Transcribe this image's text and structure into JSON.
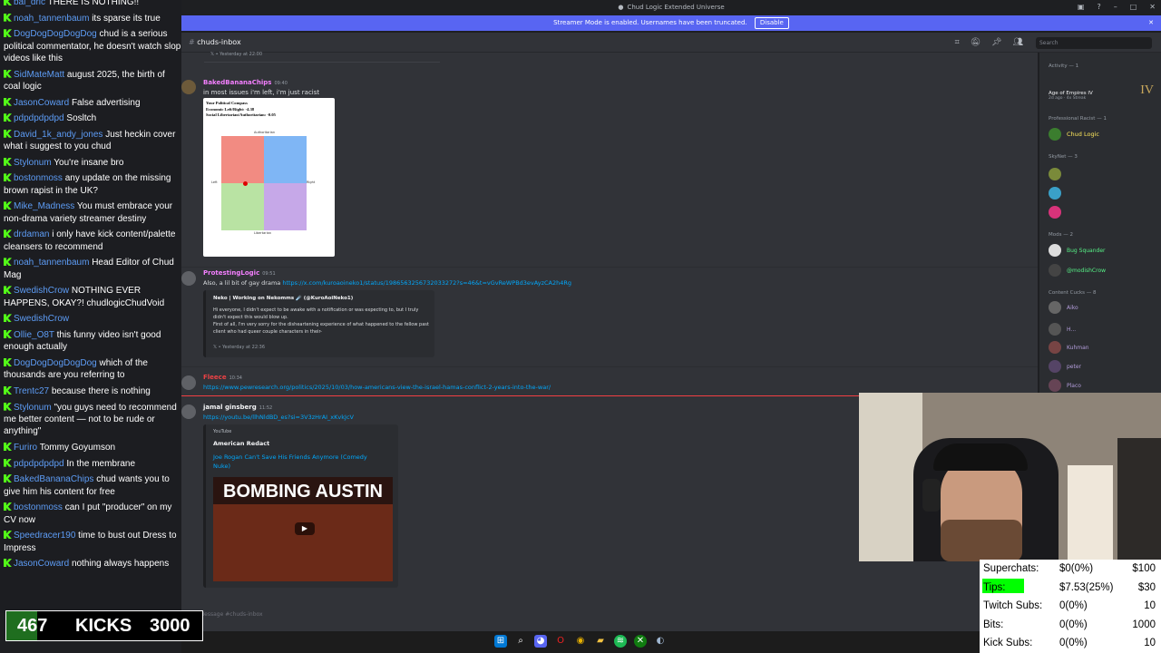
{
  "discord": {
    "window_title": "Chud Logic Extended Universe",
    "streamer_bar": {
      "text": "Streamer Mode is enabled. Usernames have been truncated.",
      "button": "Disable",
      "close": "✕"
    },
    "channel": "chuds-inbox",
    "search_placeholder": "Search",
    "message_placeholder": "Message #chuds-inbox",
    "top_embed_footer": "𝕏 • Yesterday at 22:00",
    "messages": [
      {
        "user": "BakedBananaChips",
        "time": "09:40",
        "text": "in most issues i'm left, i'm just racist",
        "color": "#f47fff"
      },
      {
        "user": "ProtestingLogic",
        "time": "09:51",
        "text": "Also, a lil bit of gay drama ",
        "link": "https://x.com/kuroaoineko1/status/1986563256732033272?s=46&t=vGvReWPBd3evAyzCA2h4Rg",
        "color": "#f47fff"
      },
      {
        "user": "Fleece",
        "time": "10:34",
        "link": "https://www.pewresearch.org/politics/2025/10/03/how-americans-view-the-israel-hamas-conflict-2-years-into-the-war/",
        "color": "#ed4245"
      },
      {
        "user": "jamal ginsberg",
        "time": "11:52",
        "link": "https://youtu.be/llhNldBD_es?si=3V3zHrAI_xKvkJcV",
        "color": "#f2f3f5"
      }
    ],
    "compass_embed": {
      "title": "Your Political Compass",
      "line1": "Economic Left/Right: -4.38",
      "line2": "Social Libertarian/Authoritarian: -0.05",
      "top": "Authoritarian",
      "bottom": "Libertarian",
      "left": "Left",
      "right": "Right"
    },
    "tweet_embed": {
      "author": "Neko | Working on Nekomms ☄️ (@KuroAoiNeko1)",
      "body": "Hi everyone, I didn't expect to be awake with a notification or was expecting to, but I truly didn't expect this would blow up.\nFirst of all, I'm very sorry for the disheartening experience of what happened to the fellow past client who had queer couple characters in their-",
      "footer": "𝕏 • Yesterday at 22:36"
    },
    "yt_embed": {
      "provider": "YouTube",
      "channel": "American Redact",
      "title": "Joe Rogan Can't Save His Friends Anymore (Comedy Nuke)",
      "thumb_text": "BOMBING AUSTIN"
    },
    "members": {
      "activity_header": "Activity — 1",
      "activity_game": "Age of Empires IV",
      "activity_meta": "2d ago · 4x Streak",
      "groups": [
        {
          "header": "Professional Racist — 1",
          "items": [
            "Chud Logic"
          ]
        },
        {
          "header": "SkyNet — 3",
          "items": [
            "",
            "",
            ""
          ]
        },
        {
          "header": "Mods — 2",
          "items": [
            "Bug Squander",
            "@modishCrow"
          ]
        },
        {
          "header": "Content Cucks — 8",
          "items": [
            "Aiko",
            "H...",
            "Kuhman",
            "peter",
            "Placo"
          ]
        }
      ]
    }
  },
  "chat": [
    {
      "user": "noah_tannenbaum",
      "text": "its sparse its true"
    },
    {
      "user": "DogDogDogDogDog",
      "text": "chud is a serious political commentator, he doesn't watch slop videos like this"
    },
    {
      "user": "SidMateMatt",
      "text": "august 2025, the birth of coal logic"
    },
    {
      "user": "JasonCoward",
      "text": "False advertising"
    },
    {
      "user": "pdpdpdpdpd",
      "text": "Sosltch"
    },
    {
      "user": "David_1k_andy_jones",
      "text": "Just heckin cover what i suggest to you chud"
    },
    {
      "user": "Stylonum",
      "text": "You're insane bro"
    },
    {
      "user": "bostonmoss",
      "text": "any update on the missing brown rapist in the UK?"
    },
    {
      "user": "Mike_Madness",
      "text": "You must embrace your non-drama variety streamer destiny"
    },
    {
      "user": "drdaman",
      "text": "i only have kick content/palette cleansers to recommend"
    },
    {
      "user": "noah_tannenbaum",
      "text": "Head Editor of Chud Mag"
    },
    {
      "user": "SwedishCrow",
      "text": "NOTHING EVER HAPPENS, OKAY?! chudlogicChudVoid"
    },
    {
      "user": "SwedishCrow",
      "text": ""
    },
    {
      "user": "Ollie_O8T",
      "text": "this funny video isn't good enough actually"
    },
    {
      "user": "DogDogDogDogDog",
      "text": "which of the thousands are you referring to"
    },
    {
      "user": "Trentc27",
      "text": "because there is nothing"
    },
    {
      "user": "Stylonum",
      "text": "\"you guys need to recommend me better content — not to be rude or anything\""
    },
    {
      "user": "Furiro",
      "text": "Tommy Goyumson"
    },
    {
      "user": "pdpdpdpdpd",
      "text": "In the membrane"
    },
    {
      "user": "BakedBananaChips",
      "text": "chud wants you to give him his content for free"
    },
    {
      "user": "bostonmoss",
      "text": "can I put \"producer\" on my CV now"
    },
    {
      "user": "Speedracer190",
      "text": "time to bust out Dress to Impress"
    },
    {
      "user": "JasonCoward",
      "text": "nothing always happens"
    }
  ],
  "chat_top": {
    "user": "bal_dric",
    "text": "THERE IS NOTHING!!"
  },
  "kicks": {
    "count": "467",
    "label": "KICKS",
    "goal": "3000",
    "progress": 0.156
  },
  "donations": [
    {
      "label": "Superchats:",
      "value": "$0(0%)",
      "goal": "$100"
    },
    {
      "label": "Tips:",
      "value": "$7.53(25%)",
      "goal": "$30"
    },
    {
      "label": "Twitch Subs:",
      "value": "0(0%)",
      "goal": "10"
    },
    {
      "label": "Bits:",
      "value": "0(0%)",
      "goal": "1000"
    },
    {
      "label": "Kick Subs:",
      "value": "0(0%)",
      "goal": "10"
    }
  ],
  "colors": {
    "accent": "#5865f2",
    "kick_green": "#53fc18",
    "tips_green": "#00ff00"
  },
  "taskbar_icons": [
    "windows-icon",
    "search-icon",
    "discord-icon",
    "opera-icon",
    "chrome-icon",
    "folder-icon",
    "spotify-icon",
    "xbox-icon",
    "steam-icon"
  ]
}
